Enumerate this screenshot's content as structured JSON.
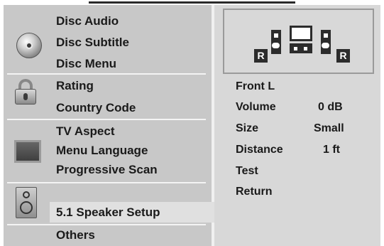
{
  "menu": {
    "groups": [
      {
        "items": [
          "Disc Audio",
          "Disc Subtitle",
          "Disc Menu"
        ]
      },
      {
        "items": [
          "Rating",
          "Country Code"
        ]
      },
      {
        "items": [
          "TV Aspect",
          "Menu Language",
          "Progressive Scan"
        ]
      },
      {
        "items": [
          "5.1 Speaker Setup"
        ]
      },
      {
        "items": [
          "Others"
        ]
      }
    ],
    "selected": "5.1 Speaker Setup"
  },
  "speaker_setup": {
    "diagram": {
      "left_rear_label": "R",
      "right_rear_label": "R"
    },
    "channel": "Front L",
    "rows": [
      {
        "label": "Volume",
        "value": "0 dB"
      },
      {
        "label": "Size",
        "value": "Small"
      },
      {
        "label": "Distance",
        "value": "1 ft"
      }
    ],
    "actions": [
      "Test",
      "Return"
    ]
  }
}
